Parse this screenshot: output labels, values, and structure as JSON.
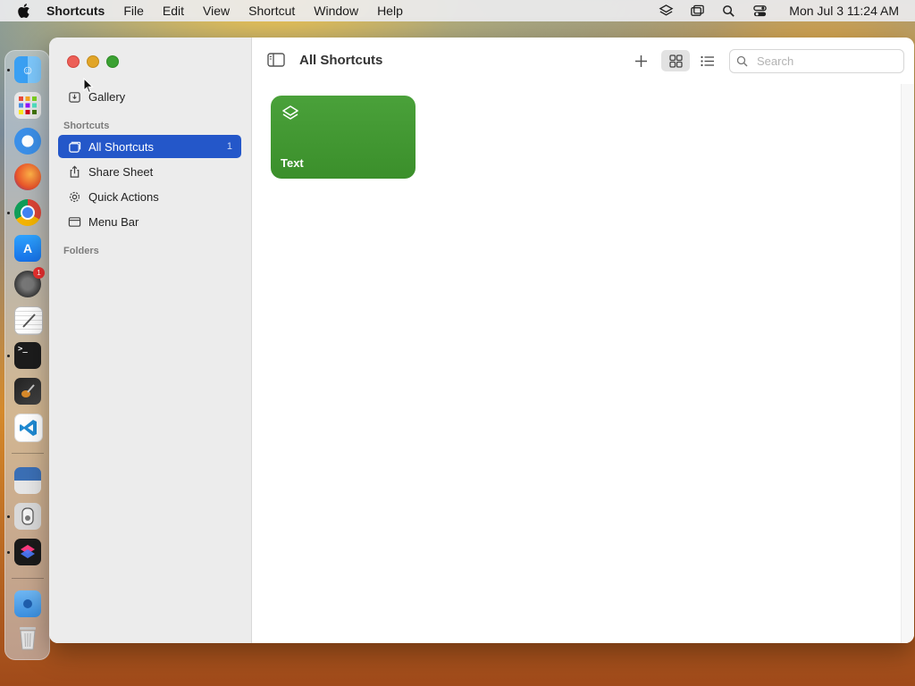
{
  "menubar": {
    "app_name": "Shortcuts",
    "menus": [
      "File",
      "Edit",
      "View",
      "Shortcut",
      "Window",
      "Help"
    ],
    "clock": "Mon Jul 3  11:24 AM",
    "status_icons": [
      "layers-icon",
      "screen-mirroring-icon",
      "spotlight-search-icon",
      "control-center-icon"
    ]
  },
  "dock": {
    "apps": [
      "finder-icon",
      "launchpad-icon",
      "safari-icon",
      "firefox-icon",
      "chrome-icon",
      "app-store-icon",
      "system-settings-icon",
      "textedit-icon",
      "terminal-icon",
      "garageband-icon",
      "vscode-icon",
      "preview-icon",
      "disk-utility-icon",
      "shortcuts-icon",
      "downloads-folder-icon",
      "trash-icon"
    ],
    "settings_badge": "1"
  },
  "sidebar": {
    "gallery": "Gallery",
    "shortcuts_header": "Shortcuts",
    "items": [
      {
        "label": "All Shortcuts",
        "count": "1"
      },
      {
        "label": "Share Sheet"
      },
      {
        "label": "Quick Actions"
      },
      {
        "label": "Menu Bar"
      }
    ],
    "folders_header": "Folders"
  },
  "main": {
    "title": "All Shortcuts",
    "search_placeholder": "Search",
    "cards": [
      {
        "label": "Text",
        "color": "#43982f"
      }
    ]
  },
  "colors": {
    "selection": "#2457c9",
    "card_green": "#43982f"
  }
}
